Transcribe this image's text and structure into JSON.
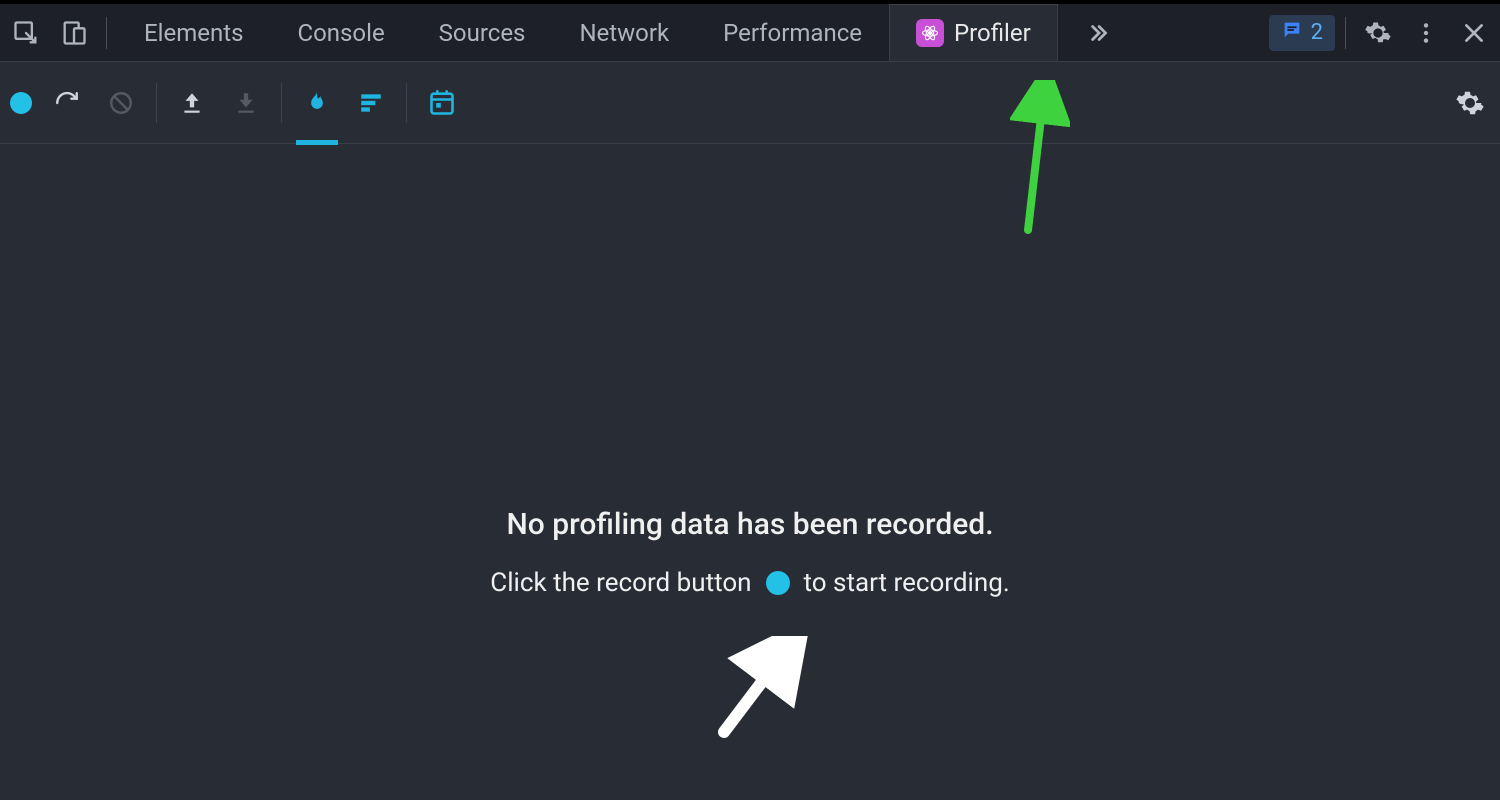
{
  "topbar": {
    "tabs": [
      {
        "label": "Elements"
      },
      {
        "label": "Console"
      },
      {
        "label": "Sources"
      },
      {
        "label": "Network"
      },
      {
        "label": "Performance"
      },
      {
        "label": "Profiler",
        "active": true
      }
    ],
    "error_count": "2",
    "icons": {
      "inspect": "inspect-element-icon",
      "device": "device-toolbar-icon",
      "more_tabs": "chevron-double-right-icon",
      "settings": "gear-icon",
      "kebab": "more-vert-icon",
      "close": "close-icon",
      "errors": "message-icon"
    }
  },
  "profiler_toolbar": {
    "buttons": {
      "record": "record-button",
      "reload": "reload-button",
      "clear": "clear-button",
      "load": "load-profile-button",
      "save": "save-profile-button",
      "flame": "flamegraph-button",
      "ranked": "ranked-button",
      "timeline": "timeline-button",
      "settings": "profiler-settings-button"
    }
  },
  "empty_state": {
    "heading": "No profiling data has been recorded.",
    "sub_before": "Click the record button",
    "sub_after": "to start recording."
  },
  "colors": {
    "accent": "#23c0e8",
    "react_badge": "#c84fd6",
    "annotation_green": "#3fd23f"
  }
}
